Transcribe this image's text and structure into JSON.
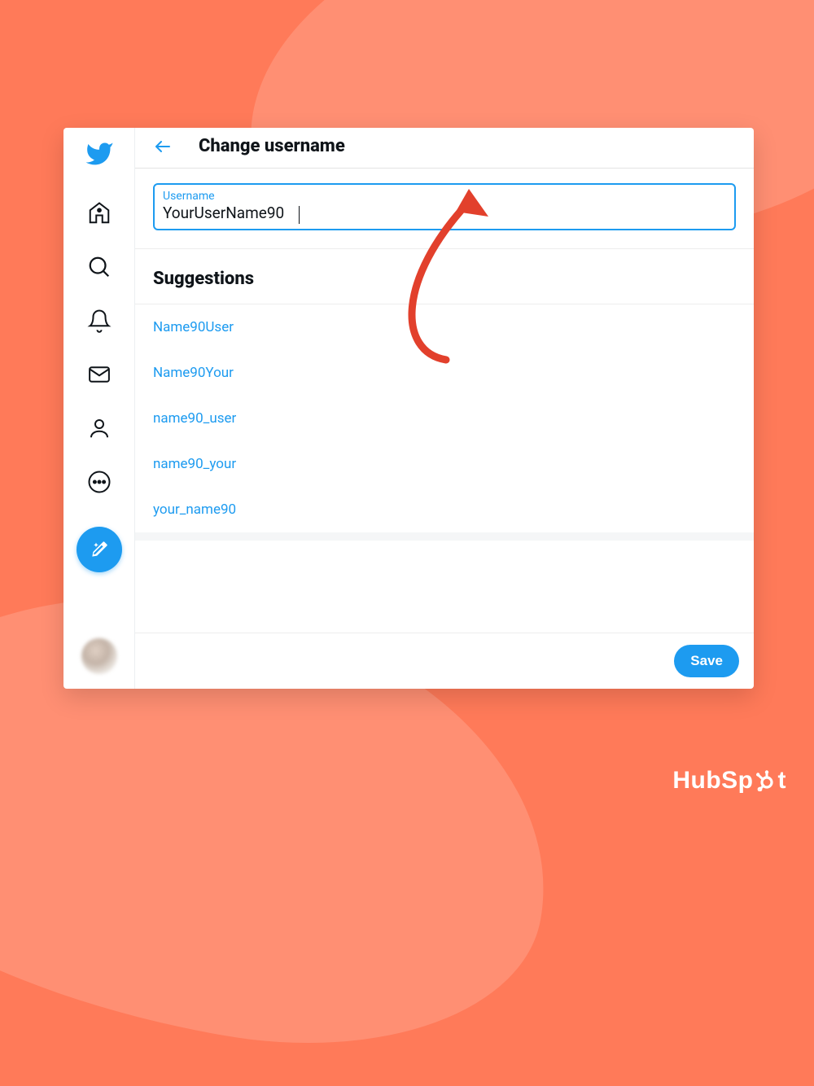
{
  "header": {
    "page_title": "Change username"
  },
  "field": {
    "label": "Username",
    "value": "YourUserName90"
  },
  "suggestions": {
    "heading": "Suggestions",
    "items": [
      "Name90User",
      "Name90Your",
      "name90_user",
      "name90_your",
      "your_name90"
    ]
  },
  "actions": {
    "save_label": "Save"
  },
  "branding": {
    "hubspot_prefix": "HubSp",
    "hubspot_suffix": "t"
  }
}
